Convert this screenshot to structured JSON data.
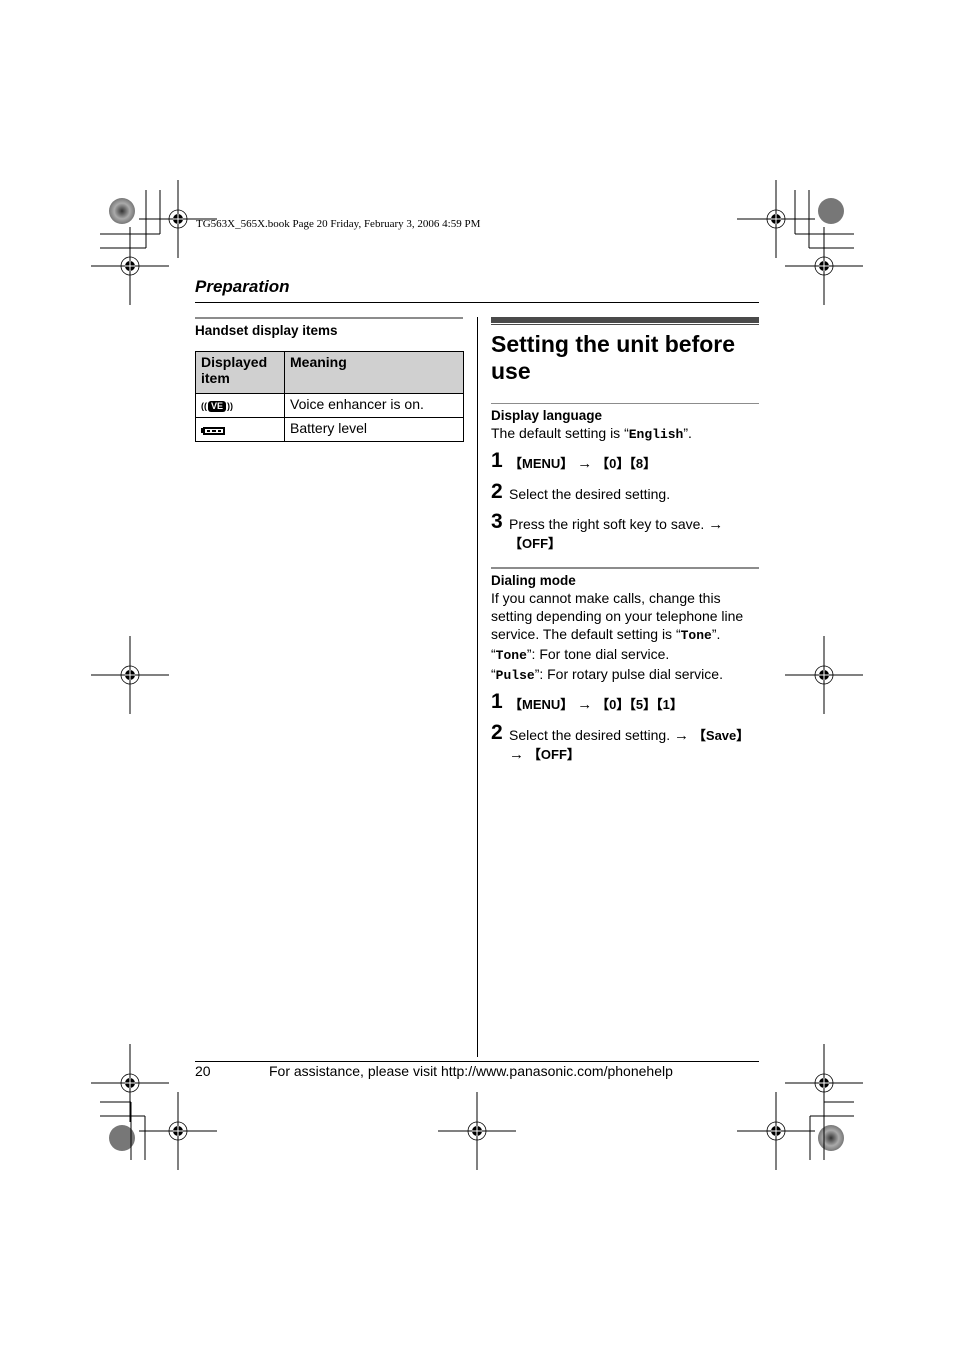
{
  "slug": {
    "text": "TG563X_565X.book  Page 20  Friday, February 3, 2006  4:59 PM"
  },
  "header": {
    "section_title": "Preparation"
  },
  "left": {
    "heading": "Handset display items",
    "table": {
      "columns": [
        "Displayed item",
        "Meaning"
      ],
      "rows": [
        {
          "icon": "voice-enhancer-icon",
          "icon_label": "VE",
          "meaning": "Voice enhancer is on."
        },
        {
          "icon": "battery-icon",
          "meaning": "Battery level"
        }
      ]
    }
  },
  "right": {
    "title": "Setting the unit before use",
    "display_language": {
      "heading": "Display language",
      "text_prefix": "The default setting is “",
      "default_value": "English",
      "text_suffix": "”.",
      "steps": [
        {
          "num": "1",
          "keys": [
            "MENU"
          ],
          "arrow": "→",
          "then_keys": [
            "0",
            "8"
          ]
        },
        {
          "num": "2",
          "text": "Select the desired setting."
        },
        {
          "num": "3",
          "text": "Press the right soft key to save.",
          "arrow": "→",
          "end_key": "OFF"
        }
      ]
    },
    "dialing_mode": {
      "heading": "Dialing mode",
      "text": "If you cannot make calls, change this setting depending on your telephone line service. The default setting is “",
      "default_value": "Tone",
      "text_suffix": "”.",
      "options": [
        {
          "value": "Tone",
          "desc": "”: For tone dial service."
        },
        {
          "value": "Pulse",
          "desc": "”: For rotary pulse dial service."
        }
      ],
      "open_quote": "“",
      "steps": [
        {
          "num": "1",
          "keys": [
            "MENU"
          ],
          "arrow": "→",
          "then_keys": [
            "0",
            "5",
            "1"
          ]
        },
        {
          "num": "2",
          "text": "Select the desired setting.",
          "arrow": "→",
          "key1": "Save",
          "key2": "OFF"
        }
      ]
    }
  },
  "footer": {
    "page_number": "20",
    "text": "For assistance, please visit http://www.panasonic.com/phonehelp"
  }
}
